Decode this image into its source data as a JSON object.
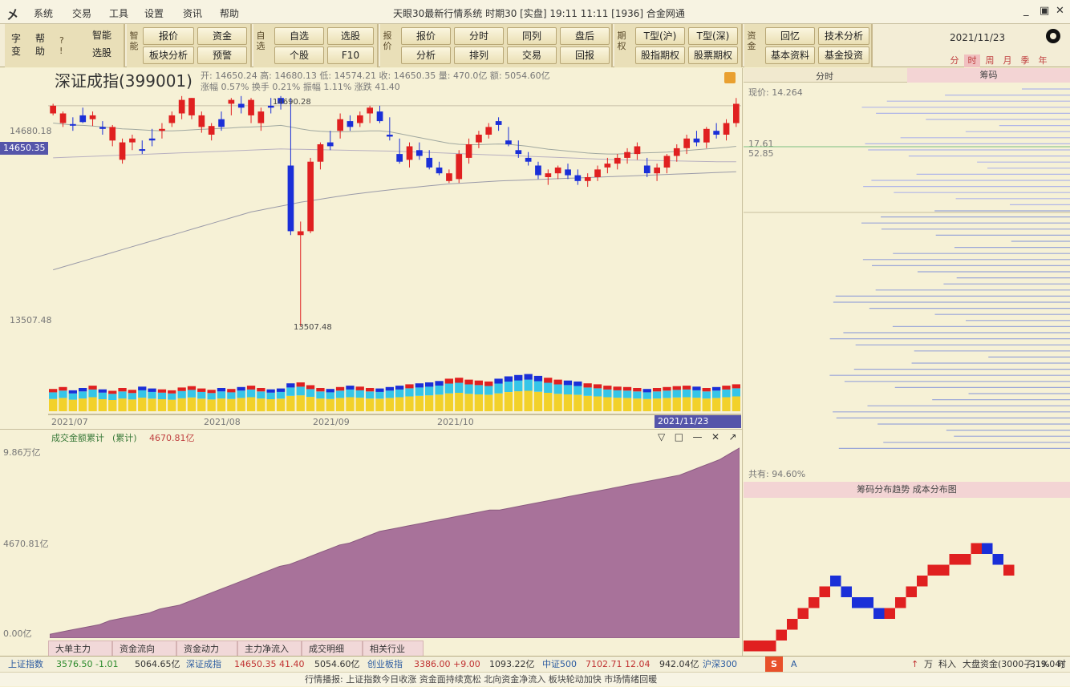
{
  "window": {
    "title": "天眼30最新行情系统  时期30  [实盘]  19:11  11:11  [1936]  合金网通",
    "menu": [
      "系统",
      "交易",
      "工具",
      "设置",
      "资讯",
      "帮助"
    ],
    "controls": [
      "_",
      "▣",
      "✕"
    ]
  },
  "toolbar": {
    "group1": {
      "left_labels": [
        "字",
        "变",
        "帮",
        "助"
      ],
      "buttons": [
        "智能",
        "选股"
      ]
    },
    "group2": {
      "vlabel": "智能",
      "buttons": [
        "报价",
        "资金",
        "板块分析",
        "预警"
      ]
    },
    "group3": {
      "vlabel": "自选",
      "buttons": [
        "自选",
        "选股",
        "个股",
        "F10"
      ]
    },
    "group4": {
      "vlabel": "报价",
      "buttons": [
        "报价",
        "分时",
        "同列",
        "盘后",
        "分析",
        "排列",
        "交易",
        "回报"
      ]
    },
    "group5": {
      "vlabel": "期权",
      "buttons": [
        "T型(沪)",
        "T型(深)",
        "股指期权",
        "股票期权"
      ]
    },
    "group6": {
      "vlabel": "资金",
      "buttons": [
        "回忆",
        "技术分析",
        "基本资料",
        "基金投资"
      ]
    },
    "date": "2021/11/23",
    "ranges": [
      "分",
      "时",
      "周",
      "月",
      "季",
      "年"
    ]
  },
  "kchart": {
    "title": "深证成指(399001)",
    "info_line1": "开: 14650.24  高: 14680.13  低: 14574.21  收: 14650.35  量: 470.0亿  额: 5054.60亿",
    "info_line2": "涨幅  0.57%  换手  0.21%  振幅  1.11%  涨跌  41.40",
    "high_label": "14690.28",
    "low_label": "13507.48",
    "current_price": "14650.35",
    "y_labels": [
      "14680.18",
      "14650.35",
      "13507.48"
    ],
    "x_labels": [
      "2021/07",
      "2021/08",
      "2021/09",
      "2021/10",
      "2021/11/23"
    ],
    "icon_names": [
      "lock-icon"
    ]
  },
  "sumchart": {
    "title": "成交金额累计",
    "param": "(累计)",
    "value": "4670.81亿",
    "y_labels": [
      "9.86万亿",
      "4670.81亿",
      "0.00亿"
    ],
    "tools": [
      "▽",
      "□",
      "—",
      "✕",
      "↗"
    ]
  },
  "rpanel": {
    "tabs": [
      "分时",
      "筹码"
    ],
    "label1": "现价: 14.264",
    "right_vals": [
      "17.61",
      "52.85"
    ],
    "bottom_label": "共有: 94.60%",
    "sub_title": "筹码分布趋势  成本分布图"
  },
  "bottom_tabs": [
    "大单主力",
    "资金流向",
    "资金动力",
    "主力净流入",
    "成交明细",
    "相关行业"
  ],
  "status": {
    "items": [
      "上证指数",
      "3576.50  -1.01",
      "5064.65亿",
      "深证成指",
      "14650.35  41.40",
      "5054.60亿",
      "创业板指",
      "3386.00  +9.00",
      "1093.22亿",
      "中证500",
      "7102.71  12.04",
      "942.04亿",
      "沪深300",
      "A",
      "↑",
      "万",
      "科入",
      "大盘资金(3000子,19.04)",
      "31%",
      "时"
    ]
  },
  "ticker": "行情播报:  上证指数今日收涨  资金面持续宽松  北向资金净流入  板块轮动加快  市场情绪回暖",
  "chart_data": [
    {
      "type": "candlestick",
      "title": "深证成指(399001)",
      "x_labels": [
        "2021/07",
        "2021/08",
        "2021/09",
        "2021/10",
        "2021/11/23"
      ],
      "ylim": [
        13400,
        14720
      ],
      "series": [
        {
          "name": "K线",
          "values": [
            [
              14610,
              14660,
              14600,
              14650,
              1
            ],
            [
              14560,
              14620,
              14540,
              14610,
              1
            ],
            [
              14550,
              14590,
              14520,
              14555,
              0
            ],
            [
              14600,
              14640,
              14560,
              14565,
              0
            ],
            [
              14580,
              14620,
              14545,
              14600,
              1
            ],
            [
              14540,
              14570,
              14500,
              14530,
              0
            ],
            [
              14470,
              14550,
              14440,
              14540,
              1
            ],
            [
              14370,
              14480,
              14350,
              14460,
              1
            ],
            [
              14460,
              14500,
              14420,
              14480,
              1
            ],
            [
              14420,
              14470,
              14400,
              14425,
              0
            ],
            [
              14480,
              14530,
              14440,
              14470,
              0
            ],
            [
              14530,
              14560,
              14480,
              14520,
              1
            ],
            [
              14560,
              14620,
              14540,
              14600,
              1
            ],
            [
              14610,
              14700,
              14580,
              14680,
              1
            ],
            [
              14600,
              14690,
              14580,
              14690,
              1
            ],
            [
              14540,
              14620,
              14510,
              14600,
              1
            ],
            [
              14500,
              14560,
              14470,
              14545,
              1
            ],
            [
              14580,
              14620,
              14520,
              14540,
              0
            ],
            [
              14660,
              14690,
              14600,
              14680,
              1
            ],
            [
              14640,
              14700,
              14610,
              14660,
              0
            ],
            [
              14600,
              14690,
              14560,
              14680,
              1
            ],
            [
              14560,
              14640,
              14520,
              14620,
              1
            ],
            [
              14650,
              14690,
              14610,
              14640,
              0
            ],
            [
              14690,
              14700,
              14630,
              14660,
              0
            ],
            [
              14340,
              14690,
              13980,
              14000,
              0
            ],
            [
              13980,
              14050,
              13507,
              14000,
              1
            ],
            [
              14000,
              14380,
              13990,
              14360,
              1
            ],
            [
              14360,
              14460,
              14320,
              14450,
              1
            ],
            [
              14460,
              14520,
              14420,
              14440,
              0
            ],
            [
              14520,
              14610,
              14480,
              14580,
              1
            ],
            [
              14570,
              14600,
              14520,
              14540,
              0
            ],
            [
              14560,
              14620,
              14540,
              14600,
              1
            ],
            [
              14610,
              14650,
              14560,
              14640,
              1
            ],
            [
              14620,
              14650,
              14560,
              14570,
              0
            ],
            [
              14490,
              14590,
              14470,
              14500,
              0
            ],
            [
              14400,
              14480,
              14350,
              14360,
              0
            ],
            [
              14370,
              14460,
              14330,
              14440,
              1
            ],
            [
              14420,
              14460,
              14370,
              14390,
              0
            ],
            [
              14380,
              14420,
              14320,
              14330,
              0
            ],
            [
              14330,
              14360,
              14290,
              14300,
              0
            ],
            [
              14300,
              14320,
              14250,
              14260,
              1
            ],
            [
              14270,
              14420,
              14250,
              14400,
              1
            ],
            [
              14380,
              14480,
              14350,
              14450,
              1
            ],
            [
              14460,
              14520,
              14430,
              14500,
              1
            ],
            [
              14500,
              14560,
              14480,
              14540,
              1
            ],
            [
              14550,
              14590,
              14520,
              14570,
              0
            ],
            [
              14470,
              14540,
              14440,
              14450,
              0
            ],
            [
              14420,
              14470,
              14380,
              14400,
              0
            ],
            [
              14360,
              14410,
              14340,
              14380,
              0
            ],
            [
              14340,
              14360,
              14270,
              14290,
              0
            ],
            [
              14280,
              14320,
              14240,
              14300,
              1
            ],
            [
              14300,
              14340,
              14270,
              14330,
              1
            ],
            [
              14320,
              14350,
              14270,
              14290,
              0
            ],
            [
              14290,
              14320,
              14240,
              14260,
              0
            ],
            [
              14260,
              14300,
              14230,
              14280,
              1
            ],
            [
              14280,
              14340,
              14260,
              14320,
              1
            ],
            [
              14330,
              14380,
              14300,
              14350,
              1
            ],
            [
              14350,
              14400,
              14320,
              14380,
              1
            ],
            [
              14380,
              14430,
              14350,
              14410,
              1
            ],
            [
              14400,
              14460,
              14370,
              14440,
              1
            ],
            [
              14340,
              14380,
              14280,
              14300,
              0
            ],
            [
              14300,
              14350,
              14260,
              14330,
              1
            ],
            [
              14330,
              14400,
              14300,
              14390,
              1
            ],
            [
              14390,
              14450,
              14360,
              14430,
              1
            ],
            [
              14430,
              14500,
              14400,
              14480,
              1
            ],
            [
              14480,
              14520,
              14440,
              14460,
              0
            ],
            [
              14460,
              14540,
              14430,
              14530,
              1
            ],
            [
              14520,
              14560,
              14480,
              14500,
              0
            ],
            [
              14500,
              14580,
              14470,
              14560,
              1
            ],
            [
              14560,
              14690,
              14540,
              14660,
              1
            ]
          ]
        }
      ],
      "moving_averages": [
        {
          "name": "MA20",
          "values": [
            14560,
            14555,
            14550,
            14548,
            14545,
            14540,
            14535,
            14530,
            14528,
            14525,
            14522,
            14520,
            14520,
            14522,
            14525,
            14528,
            14530,
            14532,
            14535,
            14538,
            14540,
            14542,
            14545,
            14548,
            14540,
            14530,
            14522,
            14518,
            14515,
            14515,
            14516,
            14518,
            14520,
            14520,
            14515,
            14505,
            14495,
            14485,
            14475,
            14465,
            14455,
            14450,
            14448,
            14448,
            14450,
            14452,
            14450,
            14445,
            14440,
            14432,
            14425,
            14420,
            14415,
            14410,
            14405,
            14402,
            14400,
            14400,
            14402,
            14405,
            14406,
            14408,
            14410,
            14414,
            14418,
            14422,
            14426,
            14430,
            14434,
            14440
          ]
        },
        {
          "name": "MA60",
          "values": [
            14380,
            14382,
            14384,
            14386,
            14388,
            14390,
            14392,
            14394,
            14396,
            14398,
            14400,
            14402,
            14404,
            14406,
            14408,
            14410,
            14412,
            14414,
            14416,
            14418,
            14420,
            14422,
            14424,
            14426,
            14425,
            14424,
            14423,
            14422,
            14421,
            14420,
            14419,
            14418,
            14417,
            14416,
            14415,
            14414,
            14412,
            14410,
            14408,
            14406,
            14404,
            14402,
            14400,
            14398,
            14396,
            14394,
            14392,
            14390,
            14388,
            14386,
            14384,
            14382,
            14380,
            14378,
            14376,
            14374,
            14372,
            14370,
            14369,
            14368,
            14367,
            14366,
            14365,
            14364,
            14363,
            14362,
            14361,
            14360,
            14360,
            14360
          ]
        },
        {
          "name": "MA120",
          "values": [
            13800,
            13815,
            13830,
            13845,
            13860,
            13875,
            13890,
            13905,
            13920,
            13935,
            13950,
            13965,
            13980,
            13995,
            14010,
            14025,
            14040,
            14055,
            14070,
            14085,
            14100,
            14110,
            14120,
            14130,
            14140,
            14150,
            14158,
            14166,
            14174,
            14182,
            14190,
            14196,
            14202,
            14208,
            14214,
            14220,
            14225,
            14230,
            14235,
            14240,
            14245,
            14248,
            14251,
            14254,
            14257,
            14260,
            14262,
            14264,
            14266,
            14268,
            14270,
            14272,
            14274,
            14276,
            14278,
            14280,
            14282,
            14284,
            14286,
            14288,
            14290,
            14292,
            14294,
            14296,
            14298,
            14300,
            14302,
            14304,
            14306,
            14308
          ]
        }
      ]
    },
    {
      "type": "bar",
      "title": "成交量",
      "series": [
        {
          "name": "成交量",
          "values": [
            0.48,
            0.52,
            0.45,
            0.5,
            0.55,
            0.47,
            0.44,
            0.5,
            0.46,
            0.53,
            0.49,
            0.47,
            0.45,
            0.51,
            0.54,
            0.49,
            0.46,
            0.5,
            0.48,
            0.52,
            0.55,
            0.5,
            0.47,
            0.49,
            0.6,
            0.62,
            0.56,
            0.5,
            0.48,
            0.52,
            0.55,
            0.53,
            0.5,
            0.49,
            0.52,
            0.55,
            0.58,
            0.6,
            0.62,
            0.65,
            0.7,
            0.72,
            0.68,
            0.66,
            0.64,
            0.7,
            0.75,
            0.78,
            0.8,
            0.76,
            0.72,
            0.68,
            0.66,
            0.64,
            0.6,
            0.58,
            0.55,
            0.53,
            0.52,
            0.5,
            0.48,
            0.5,
            0.52,
            0.54,
            0.55,
            0.53,
            0.5,
            0.52,
            0.55,
            0.58
          ]
        }
      ]
    },
    {
      "type": "area",
      "title": "成交金额累计",
      "ylabel": "",
      "ylim": [
        0,
        100
      ],
      "series": [
        {
          "name": "累计",
          "values": [
            2,
            3,
            4,
            5,
            6,
            7,
            9,
            10,
            11,
            12,
            13,
            15,
            16,
            17,
            19,
            21,
            23,
            25,
            27,
            29,
            31,
            33,
            35,
            37,
            38,
            40,
            42,
            44,
            46,
            48,
            49,
            51,
            53,
            55,
            56,
            57,
            58,
            59,
            60,
            61,
            62,
            63,
            64,
            65,
            66,
            66,
            67,
            68,
            69,
            70,
            71,
            72,
            73,
            74,
            75,
            76,
            77,
            78,
            79,
            80,
            81,
            82,
            83,
            84,
            86,
            88,
            90,
            92,
            95,
            98
          ]
        }
      ]
    }
  ]
}
